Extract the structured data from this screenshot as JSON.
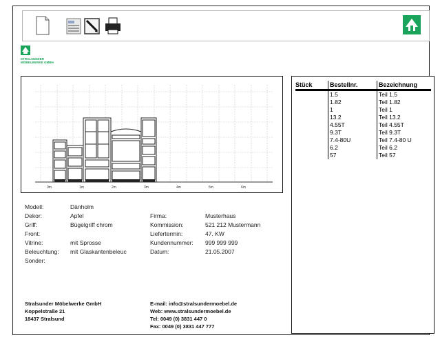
{
  "toolbar": {
    "buttons": [
      "new-document-icon",
      "parts-list-icon",
      "edit-pen-icon",
      "printer-icon"
    ],
    "logo_icon": "stralsunder-logo-icon"
  },
  "brand": {
    "line1": "STRALSUNDER",
    "line2": "MÖBELWERKE GMBH",
    "color": "#1aa35a"
  },
  "plan": {
    "axis_ticks": [
      "0m",
      "1m",
      "2m",
      "3m",
      "4m",
      "5m",
      "6m"
    ]
  },
  "details": {
    "modell": {
      "label": "Modell:",
      "value": "Dänholm"
    },
    "dekor": {
      "label": "Dekor:",
      "value": "Apfel"
    },
    "griff": {
      "label": "Griff:",
      "value": "Bügelgriff chrom"
    },
    "front": {
      "label": "Front:",
      "value": ""
    },
    "vitrine": {
      "label": "Vitrine:",
      "value": "mit Sprosse"
    },
    "beleuchtung": {
      "label": "Beleuchtung:",
      "value": "mit Glaskantenbeleuc"
    },
    "sonder": {
      "label": "Sonder:",
      "value": ""
    },
    "firma": {
      "label": "Firma:",
      "value": "Musterhaus"
    },
    "kommission": {
      "label": "Kommission:",
      "value": "521 212 Mustermann"
    },
    "liefertermin": {
      "label": "Liefertermin:",
      "value": "47. KW"
    },
    "kundennummer": {
      "label": "Kundennummer:",
      "value": "999 999 999"
    },
    "datum": {
      "label": "Datum:",
      "value": "21.05.2007"
    }
  },
  "footer": {
    "company": "Stralsunder Möbelwerke GmbH",
    "street": "Koppelstraße 21",
    "city": "18437 Stralsund",
    "email": "E-mail: info@stralsundermoebel.de",
    "web": "Web: www.stralsundermoebel.de",
    "tel": "Tel: 0049 (0) 3831 447 0",
    "fax": "Fax: 0049 (0) 3831 447 777"
  },
  "parts": {
    "headers": [
      "Stück",
      "Bestellnr.",
      "Bezeichnung"
    ],
    "rows": [
      {
        "stueck": "",
        "nr": "1.5",
        "bez": "Teil 1.5"
      },
      {
        "stueck": "",
        "nr": "1.82",
        "bez": "Teil 1.82"
      },
      {
        "stueck": "",
        "nr": "1",
        "bez": "Teil 1"
      },
      {
        "stueck": "",
        "nr": "13.2",
        "bez": "Teil 13.2"
      },
      {
        "stueck": "",
        "nr": "4.55T",
        "bez": "Teil 4.55T"
      },
      {
        "stueck": "",
        "nr": "9.3T",
        "bez": "Teil 9.3T"
      },
      {
        "stueck": "",
        "nr": "7.4-80U",
        "bez": "Teil 7.4-80 U"
      },
      {
        "stueck": "",
        "nr": "6.2",
        "bez": "Teil 6.2"
      },
      {
        "stueck": "",
        "nr": "57",
        "bez": "Teil 57"
      }
    ]
  }
}
